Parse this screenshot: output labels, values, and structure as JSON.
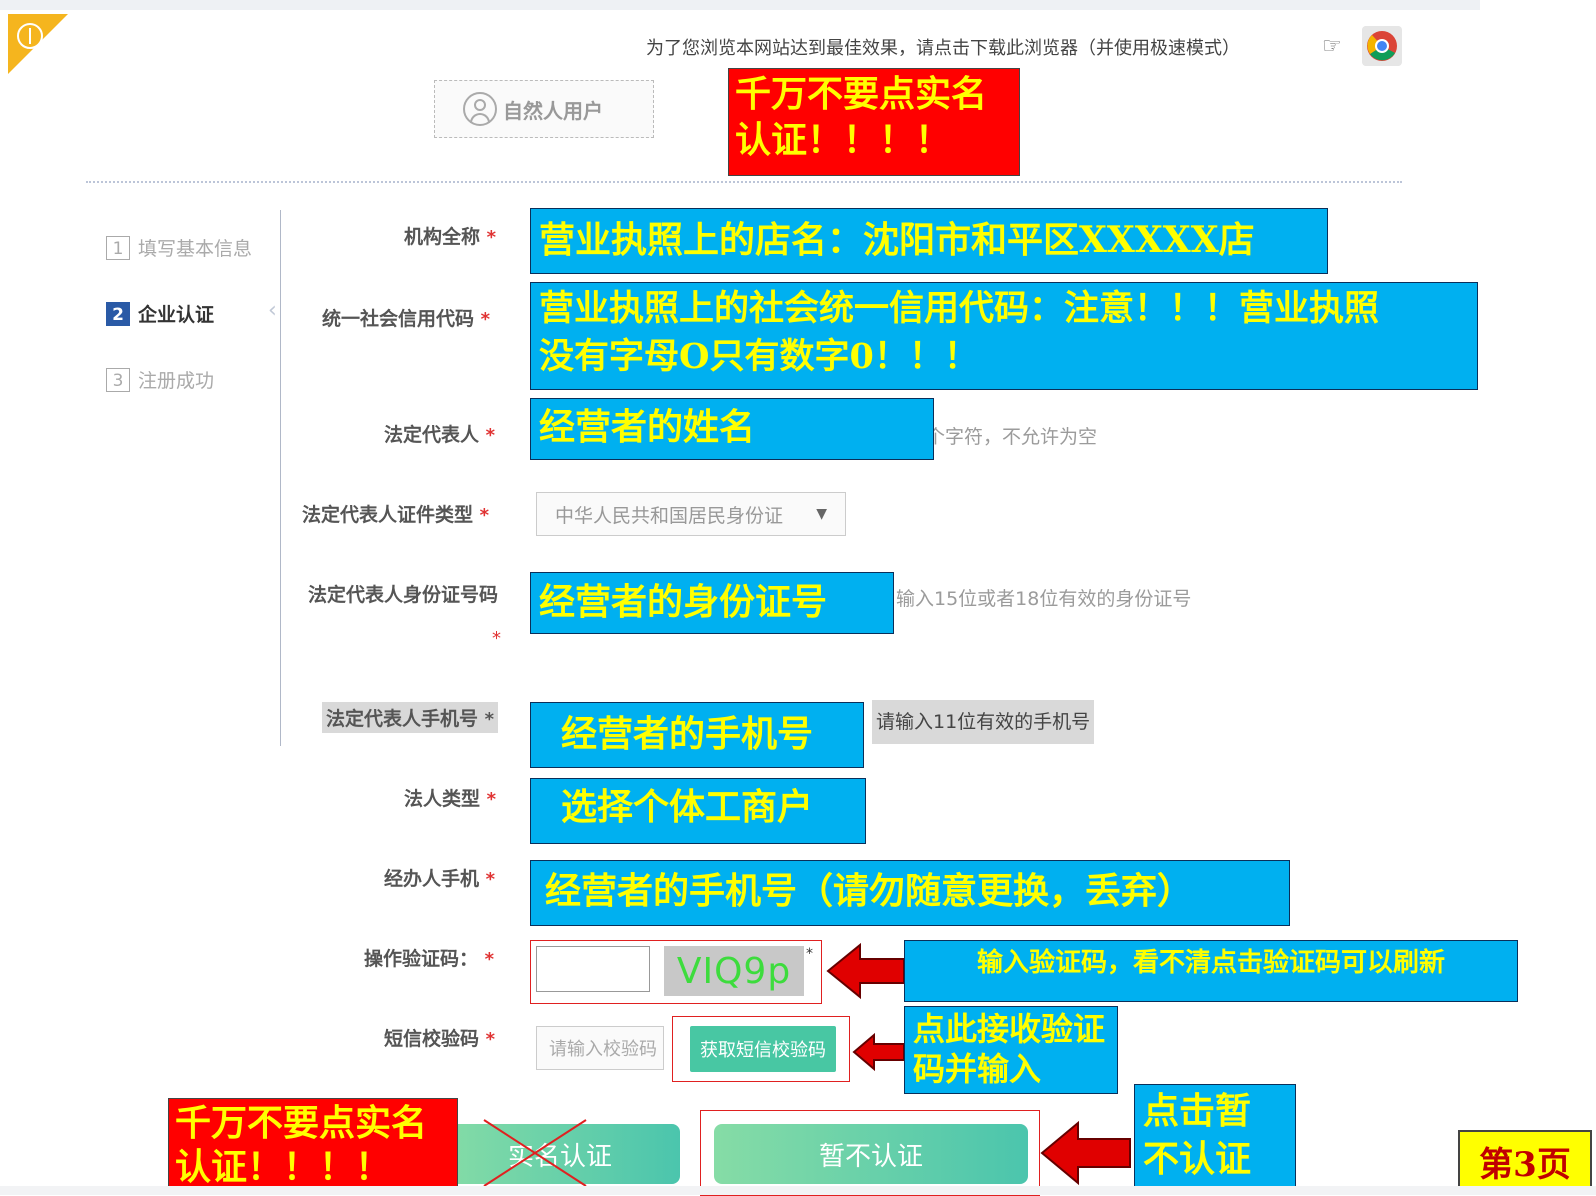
{
  "header": {
    "browser_notice": "为了您浏览本网站达到最佳效果，请点击下载此浏览器（并使用极速模式）",
    "user_tab_label": "自然人用户"
  },
  "steps": [
    {
      "num": "1",
      "label": "填写基本信息"
    },
    {
      "num": "2",
      "label": "企业认证"
    },
    {
      "num": "3",
      "label": "注册成功"
    }
  ],
  "form": {
    "org_name_label": "机构全称",
    "credit_code_label": "统一社会信用代码",
    "legal_rep_label": "法定代表人",
    "legal_rep_hint": "个字符，不允许为空",
    "id_type_label": "法定代表人证件类型",
    "id_type_value": "中华人民共和国居民身份证",
    "id_number_label": "法定代表人身份证号码",
    "id_number_hint": "输入15位或者18位有效的身份证号",
    "phone_label": "法定代表人手机号",
    "phone_hint": "请输入11位有效的手机号",
    "entity_type_label": "法人类型",
    "agent_phone_label": "经办人手机",
    "captcha_label": "操作验证码：",
    "captcha_text": "VIQ9p",
    "sms_label": "短信校验码",
    "sms_placeholder": "请输入校验码",
    "sms_button": "获取短信校验码",
    "required_mark": "*",
    "verify_button": "实名认证",
    "skip_button": "暂不认证"
  },
  "annotations": {
    "warning_top": [
      "千万不要点实名",
      "认证！！！！"
    ],
    "warning_bottom": [
      "千万不要点实名",
      "认证！！！！"
    ],
    "org_name": "营业执照上的店名：沈阳市和平区XXXXX店",
    "credit_code": [
      "营业执照上的社会统一信用代码：注意！！！营业执照",
      "没有字母O只有数字0！！！"
    ],
    "legal_rep": "经营者的姓名",
    "id_number": "经营者的身份证号",
    "phone": "经营者的手机号",
    "entity_type": "选择个体工商户",
    "agent_phone": "经营者的手机号（请勿随意更换，丢弃）",
    "captcha": "输入验证码，看不清点击验证码可以刷新",
    "sms": [
      "点此接收验证",
      "码并输入"
    ],
    "skip": [
      "点击暂",
      "不认证"
    ],
    "page": "第3页"
  },
  "colors": {
    "annotation_blue": "#00b0f0",
    "annotation_text": "#ffff00",
    "warning_red": "#ff0000",
    "button_green": "#4bc5ad",
    "step_active": "#2a5aa6"
  }
}
